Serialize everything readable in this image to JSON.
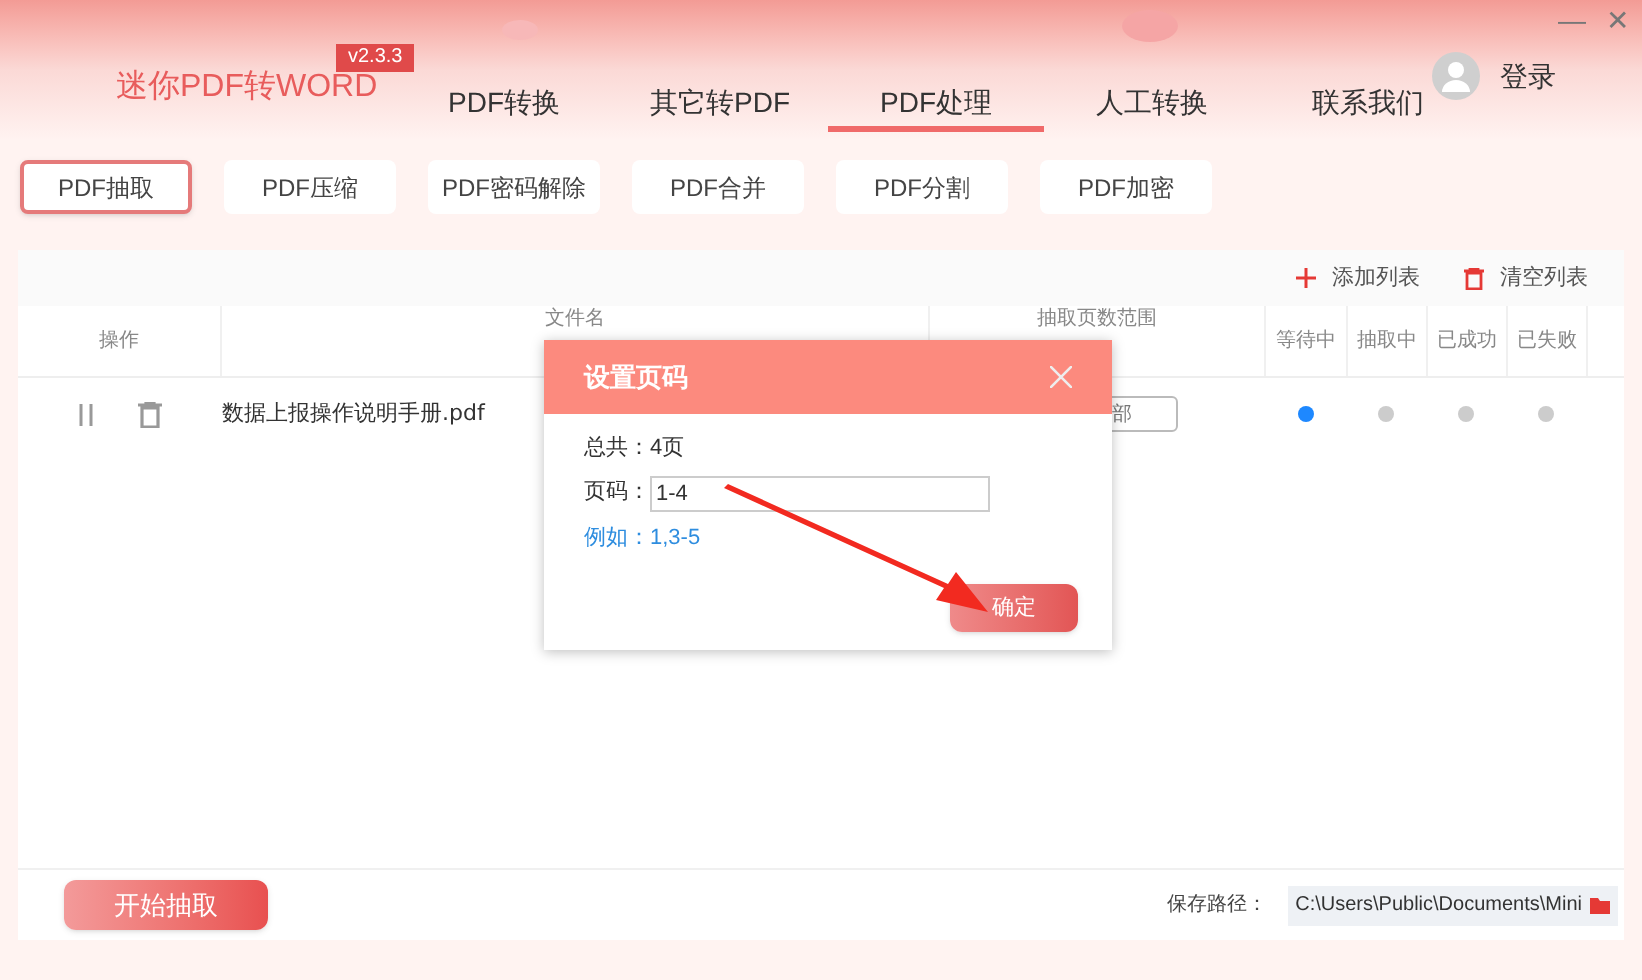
{
  "app": {
    "name": "迷你PDF转WORD",
    "version": "v2.3.3"
  },
  "window_controls": [
    "—",
    "✕"
  ],
  "nav": [
    {
      "label": "PDF转换",
      "selected": false
    },
    {
      "label": "其它转PDF",
      "selected": false
    },
    {
      "label": "PDF处理",
      "selected": true
    },
    {
      "label": "人工转换",
      "selected": false
    },
    {
      "label": "联系我们",
      "selected": false
    }
  ],
  "login": "登录",
  "subtabs": [
    {
      "label": "PDF抽取",
      "selected": true
    },
    {
      "label": "PDF压缩",
      "selected": false
    },
    {
      "label": "PDF密码解除",
      "selected": false
    },
    {
      "label": "PDF合并",
      "selected": false
    },
    {
      "label": "PDF分割",
      "selected": false
    },
    {
      "label": "PDF加密",
      "selected": false
    }
  ],
  "toolbar": {
    "add": "添加列表",
    "clear": "清空列表"
  },
  "table": {
    "columns": [
      "操作",
      "文件名",
      "抽取页数范围",
      "等待中",
      "抽取中",
      "已成功",
      "已失败"
    ],
    "rows": [
      {
        "file": "数据上报操作说明手册.pdf",
        "range": "部",
        "status": [
          {
            "color": "#1e88ff"
          },
          {
            "color": "#cccccc"
          },
          {
            "color": "#cccccc"
          },
          {
            "color": "#cccccc"
          }
        ]
      }
    ]
  },
  "dialog": {
    "title": "设置页码",
    "total": "总共：4页",
    "page_label": "页码：",
    "page_value": "1-4",
    "example": "例如：1,3-5",
    "confirm": "确定"
  },
  "footer": {
    "start": "开始抽取",
    "path_label": "保存路径：",
    "path": "C:\\Users\\Public\\Documents\\Mini"
  }
}
